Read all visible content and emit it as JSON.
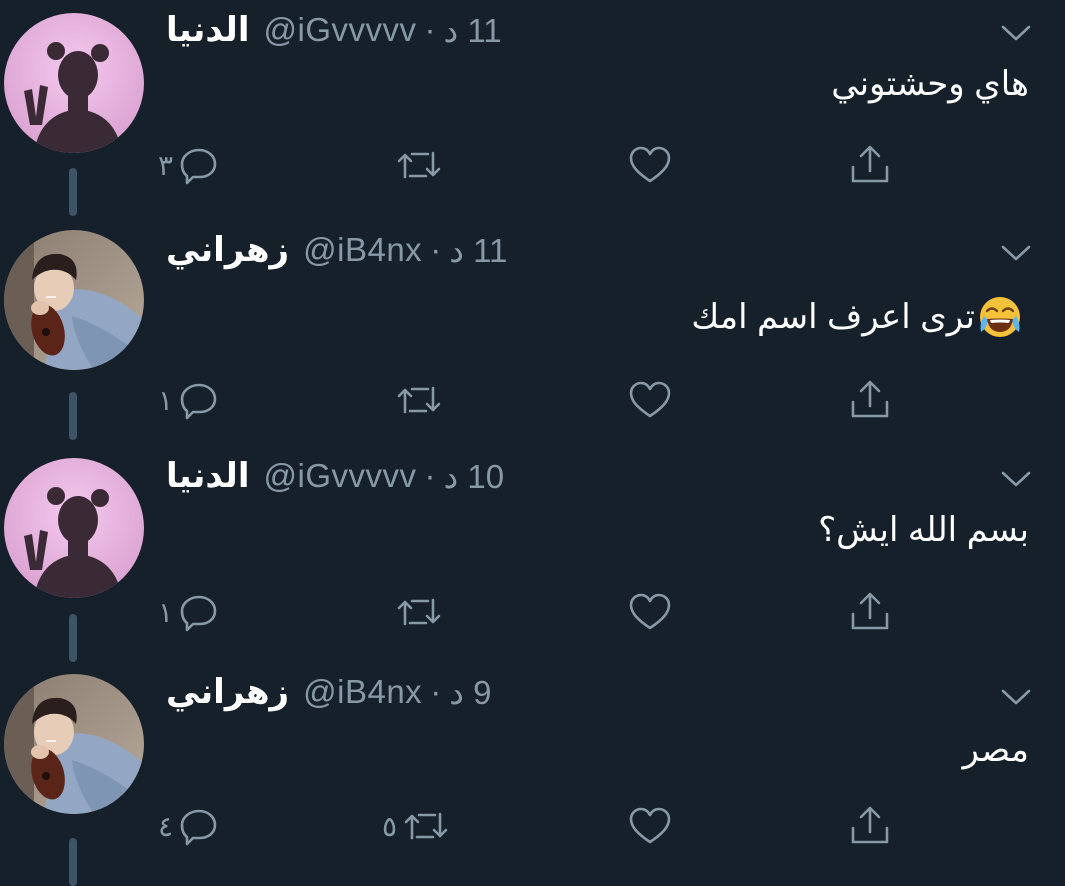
{
  "tweets": [
    {
      "name": "الدنيا",
      "handle": "@iGvvvvv",
      "separator": "·",
      "time": "11 د",
      "text": "هاي وحشتوني",
      "has_emoji": false,
      "avatar": "girl-silhouette-avatar",
      "counts": {
        "reply": "٣",
        "retweet": "",
        "like": ""
      }
    },
    {
      "name": "زهراني",
      "handle": "@iB4nx",
      "separator": "·",
      "time": "11 د",
      "text": "ترى اعرف اسم امك",
      "has_emoji": true,
      "emoji": "face-with-tears-of-joy",
      "avatar": "boy-guitar-avatar",
      "counts": {
        "reply": "١",
        "retweet": "",
        "like": ""
      }
    },
    {
      "name": "الدنيا",
      "handle": "@iGvvvvv",
      "separator": "·",
      "time": "10 د",
      "text": "بسم الله ايش؟",
      "has_emoji": false,
      "avatar": "girl-silhouette-avatar",
      "counts": {
        "reply": "١",
        "retweet": "",
        "like": ""
      }
    },
    {
      "name": "زهراني",
      "handle": "@iB4nx",
      "separator": "·",
      "time": "9 د",
      "text": "مصر",
      "has_emoji": false,
      "avatar": "boy-guitar-avatar",
      "counts": {
        "reply": "٤",
        "retweet": "٥",
        "like": ""
      }
    }
  ],
  "icons": {
    "reply": "reply-icon",
    "retweet": "retweet-icon",
    "like": "heart-icon",
    "share": "share-icon",
    "menu": "chevron-down-icon"
  },
  "colors": {
    "background": "#15202b",
    "secondary_text": "#8899a6",
    "thread_line": "#3d5466",
    "primary_text": "#ffffff"
  }
}
